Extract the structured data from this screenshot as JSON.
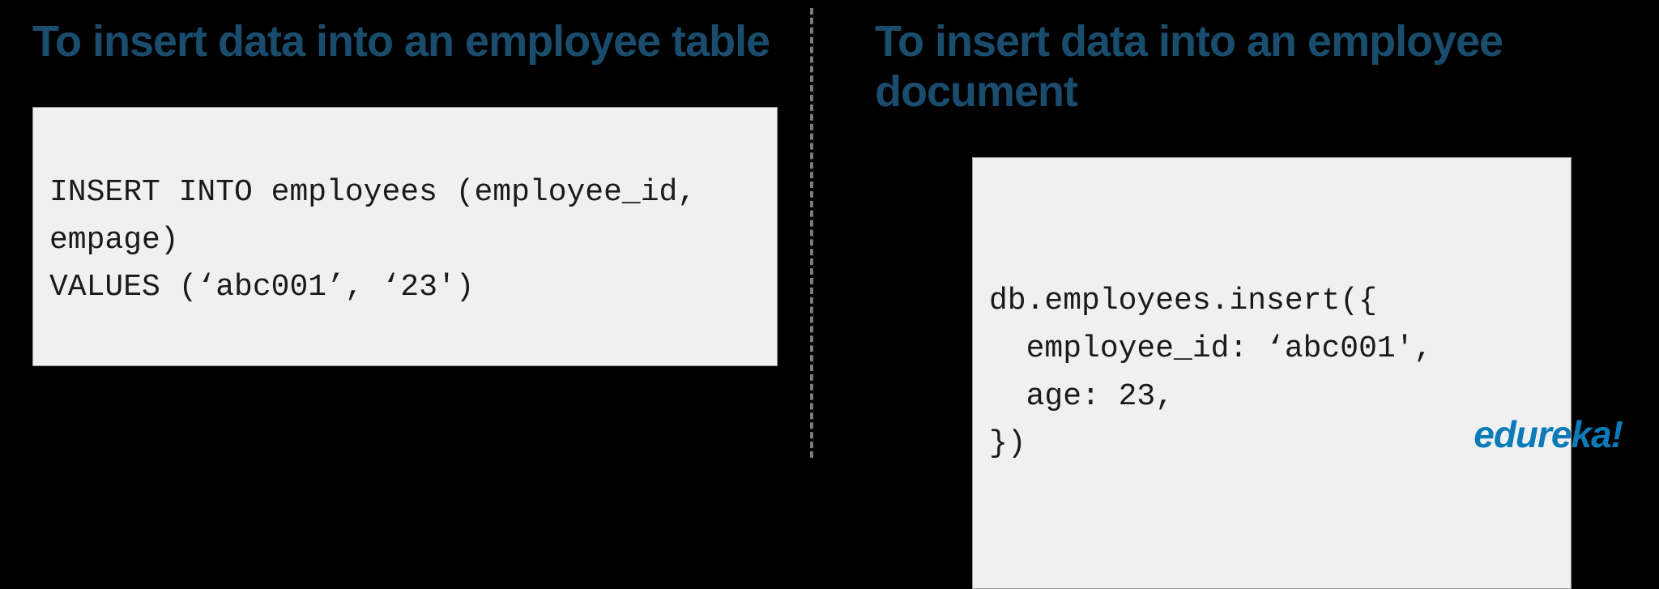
{
  "left": {
    "heading": "To insert data into an employee table",
    "code": "INSERT INTO employees (employee_id, empage)\nVALUES (‘abc001’, ‘23')"
  },
  "right": {
    "heading": "To insert data into an employee document",
    "code": "db.employees.insert({\n  employee_id: ‘abc001',\n  age: 23,\n})"
  },
  "logo": "edureka!"
}
